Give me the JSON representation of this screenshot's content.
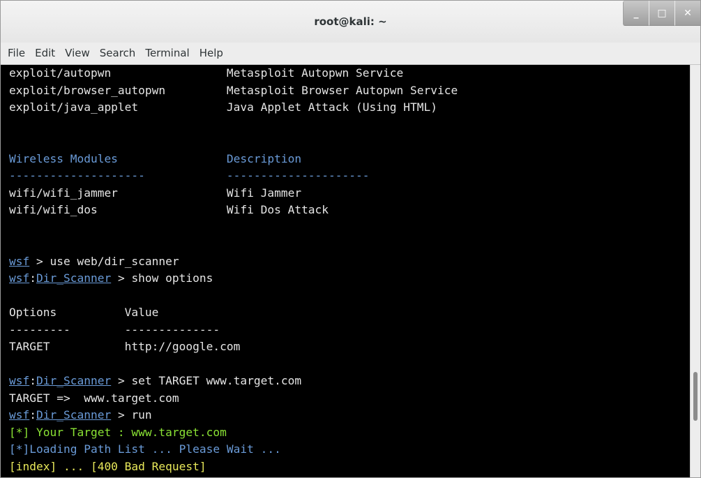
{
  "window": {
    "title": "root@kali: ~",
    "minimize_glyph": "_",
    "maximize_glyph": "□",
    "close_glyph": "✕"
  },
  "menu": {
    "items": [
      "File",
      "Edit",
      "View",
      "Search",
      "Terminal",
      "Help"
    ]
  },
  "terminal": {
    "lines": [
      {
        "segments": [
          {
            "text": "exploit/autopwn                 Metasploit Autopwn Service",
            "style": "white"
          }
        ]
      },
      {
        "segments": [
          {
            "text": "exploit/browser_autopwn         Metasploit Browser Autopwn Service",
            "style": "white"
          }
        ]
      },
      {
        "segments": [
          {
            "text": "exploit/java_applet             Java Applet Attack (Using HTML)",
            "style": "white"
          }
        ]
      },
      {
        "segments": []
      },
      {
        "segments": []
      },
      {
        "segments": [
          {
            "text": "Wireless Modules                Description",
            "style": "blue"
          }
        ]
      },
      {
        "segments": [
          {
            "text": "--------------------            ---------------------",
            "style": "blue"
          }
        ]
      },
      {
        "segments": [
          {
            "text": "wifi/wifi_jammer                Wifi Jammer",
            "style": "white"
          }
        ]
      },
      {
        "segments": [
          {
            "text": "wifi/wifi_dos                   Wifi Dos Attack",
            "style": "white"
          }
        ]
      },
      {
        "segments": []
      },
      {
        "segments": []
      },
      {
        "segments": [
          {
            "text": "wsf",
            "style": "link"
          },
          {
            "text": " > use web/dir_scanner",
            "style": "white"
          }
        ]
      },
      {
        "segments": [
          {
            "text": "wsf",
            "style": "link"
          },
          {
            "text": ":",
            "style": "white"
          },
          {
            "text": "Dir_Scanner",
            "style": "link"
          },
          {
            "text": " > show options",
            "style": "white"
          }
        ]
      },
      {
        "segments": []
      },
      {
        "segments": [
          {
            "text": "Options          Value",
            "style": "white"
          }
        ]
      },
      {
        "segments": [
          {
            "text": "---------        --------------",
            "style": "white"
          }
        ]
      },
      {
        "segments": [
          {
            "text": "TARGET           http://google.com",
            "style": "white"
          }
        ]
      },
      {
        "segments": []
      },
      {
        "segments": [
          {
            "text": "wsf",
            "style": "link"
          },
          {
            "text": ":",
            "style": "white"
          },
          {
            "text": "Dir_Scanner",
            "style": "link"
          },
          {
            "text": " > set TARGET www.target.com",
            "style": "white"
          }
        ]
      },
      {
        "segments": [
          {
            "text": "TARGET =>  www.target.com",
            "style": "white"
          }
        ]
      },
      {
        "segments": [
          {
            "text": "wsf",
            "style": "link"
          },
          {
            "text": ":",
            "style": "white"
          },
          {
            "text": "Dir_Scanner",
            "style": "link"
          },
          {
            "text": " > run",
            "style": "white"
          }
        ]
      },
      {
        "segments": [
          {
            "text": "[*] Your Target : www.target.com",
            "style": "green"
          }
        ]
      },
      {
        "segments": [
          {
            "text": "[*]Loading Path List ... Please Wait ...",
            "style": "blue"
          }
        ]
      },
      {
        "segments": [
          {
            "text": "[index] ... [400 Bad Request]",
            "style": "yellow"
          }
        ]
      }
    ]
  },
  "colors": {
    "terminal_bg": "#000000",
    "text": "#e5e5e5",
    "blue": "#6a9bd8",
    "green": "#8ae234",
    "yellow": "#e8e85a"
  }
}
